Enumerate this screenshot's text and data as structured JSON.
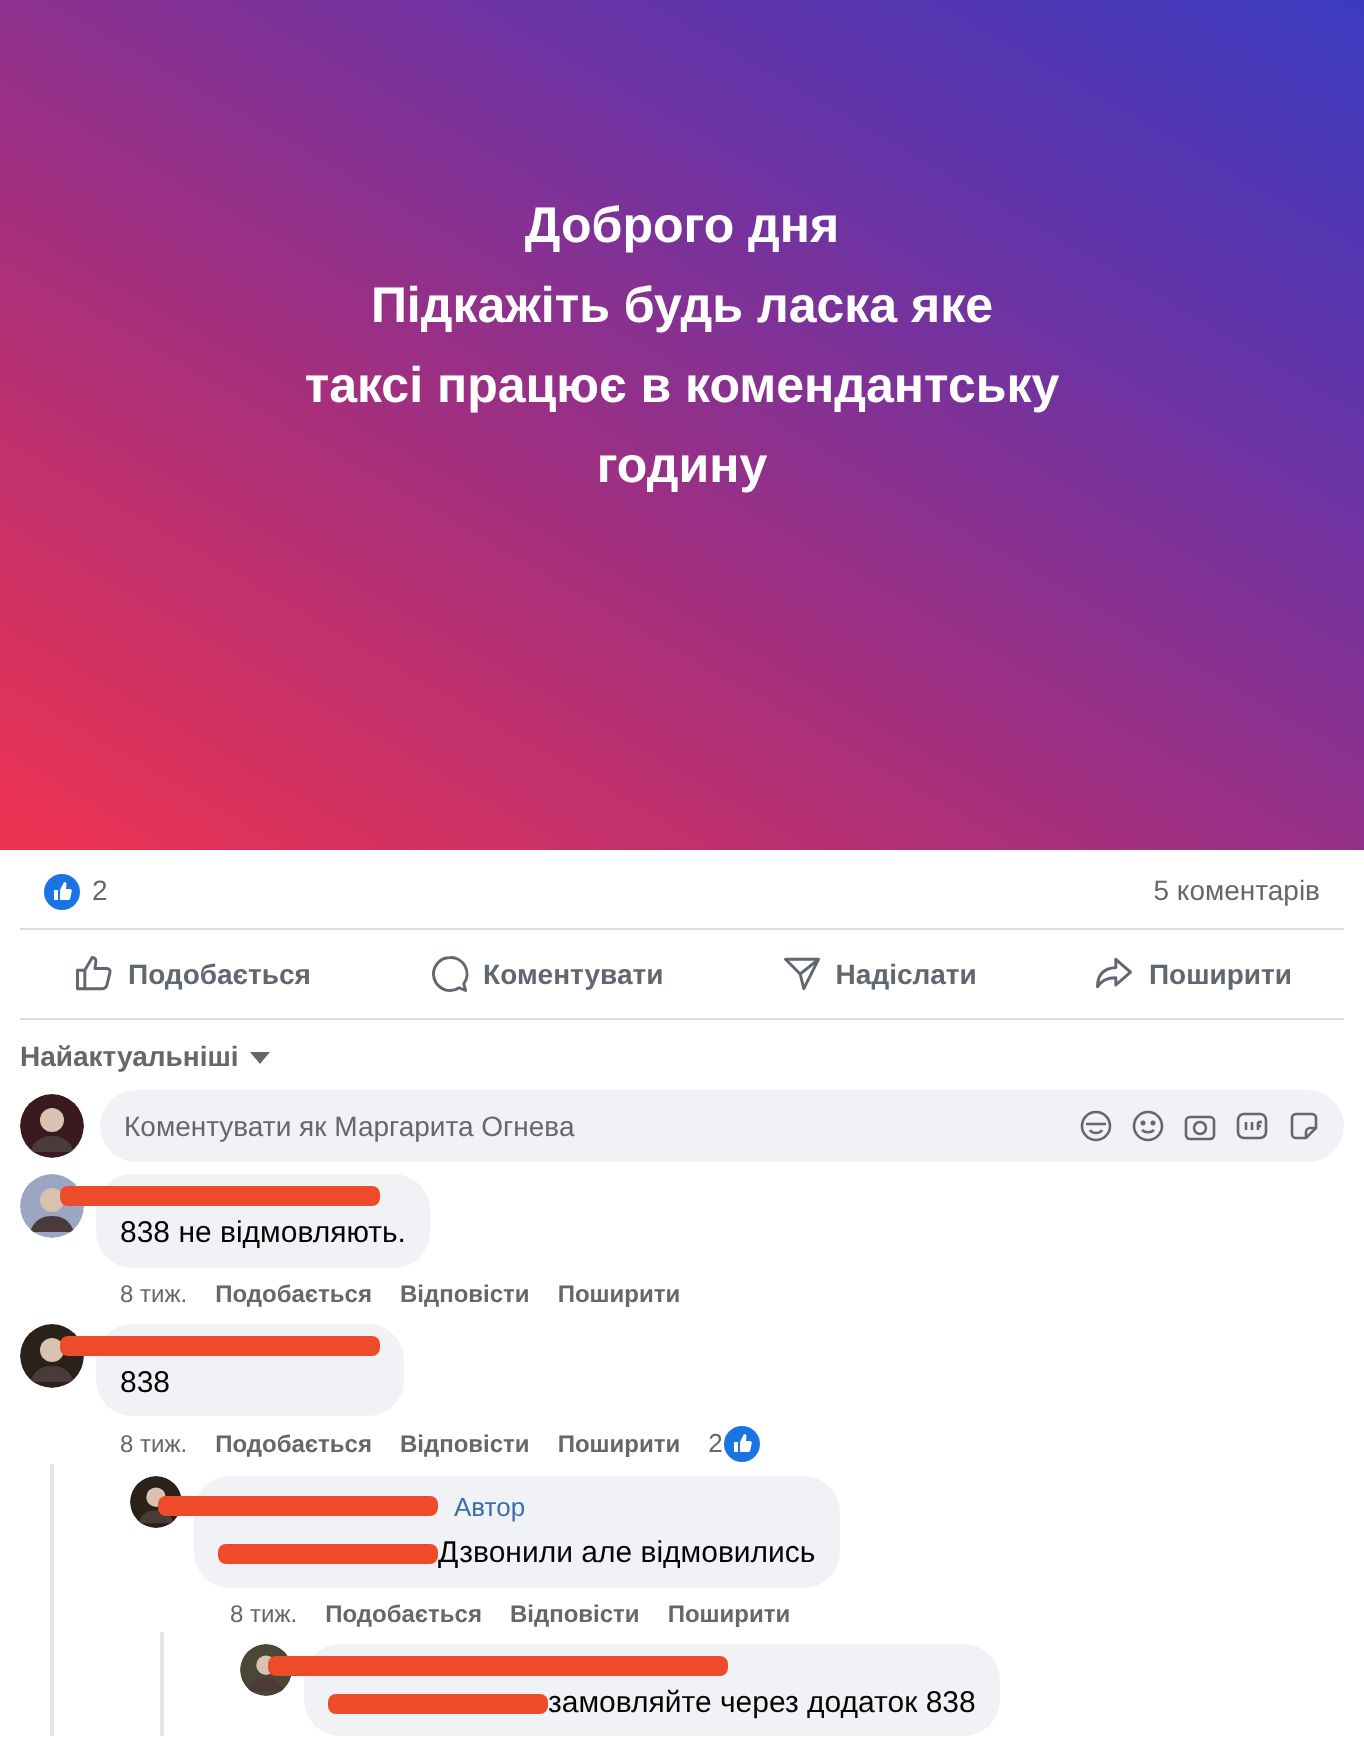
{
  "post": {
    "lines": [
      "Доброго дня",
      "Підкажіть будь ласка яке",
      "таксі працює в комендантську",
      "годину"
    ]
  },
  "stats": {
    "reactions": "2",
    "comments": "5 коментарів"
  },
  "actions": [
    {
      "kind": "like",
      "label": "Подобається"
    },
    {
      "kind": "comment",
      "label": "Коментувати"
    },
    {
      "kind": "send",
      "label": "Надіслати"
    },
    {
      "kind": "share",
      "label": "Поширити"
    }
  ],
  "sort": {
    "label": "Найактуальніші"
  },
  "composer": {
    "placeholder": "Коментувати як Маргарита Огнева"
  },
  "comments": [
    {
      "text": "838 не відмовляють.",
      "actions": [
        "8 тиж.",
        "Подобається",
        "Відповісти",
        "Поширити"
      ]
    },
    {
      "text": "838",
      "actions": [
        "8 тиж.",
        "Подобається",
        "Відповісти",
        "Поширити"
      ],
      "reactions": "2",
      "children": [
        {
          "badge": "Автор",
          "text": "Дзвонили але відмовились",
          "redacted_mention": true,
          "actions": [
            "8 тиж.",
            "Подобається",
            "Відповісти",
            "Поширити"
          ],
          "children": [
            {
              "text": "замовляйте через додаток 838",
              "redacted_mention": true
            }
          ]
        }
      ]
    }
  ]
}
